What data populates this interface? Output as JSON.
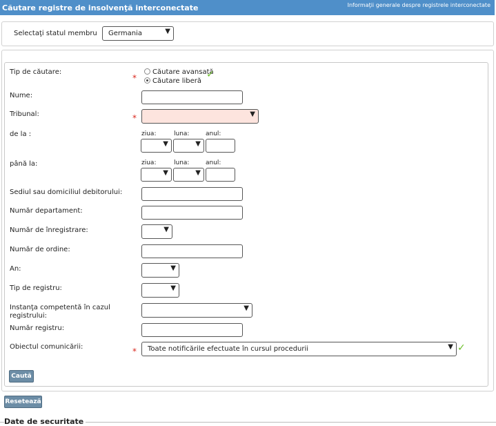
{
  "header": {
    "title": "Căutare registre de insolvenţă interconectate",
    "info_link": "Informaţii generale despre registrele interconectate"
  },
  "member_state": {
    "label": "Selectaţi statul membru",
    "selected": "Germania"
  },
  "search_type": {
    "label": "Tip de căutare:",
    "options": [
      "Căutare avansată",
      "Căutare liberă"
    ],
    "selected_index": 1
  },
  "fields": {
    "name_label": "Nume:",
    "court_label": "Tribunal:",
    "from_label": "de la :",
    "to_label": "până la:",
    "day_label": "ziua:",
    "month_label": "luna:",
    "year_label": "anul:",
    "seat_label": "Sediul sau domiciliul debitorului:",
    "department_label": "Număr departament:",
    "registration_label": "Număr de înregistrare:",
    "order_label": "Număr de ordine:",
    "year_field_label": "An:",
    "register_type_label": "Tip de registru:",
    "competent_court_label": "Instanţa competentă în cazul registrului:",
    "register_number_label": "Număr registru:",
    "subject_label": "Obiectul comunicării:",
    "subject_value": "Toate notificările efectuate în cursul procedurii"
  },
  "buttons": {
    "search": "Caută",
    "reset": "Resetează"
  },
  "security": {
    "title": "Date de securitate"
  },
  "colors": {
    "header_bg": "#4f8fc9",
    "required_star": "#d9261c",
    "valid_check": "#6cbf2a",
    "court_field_bg": "#fde4de",
    "button_bg": "#6c8da6"
  },
  "icons": {
    "required": "asterisk",
    "valid": "check-icon",
    "dropdown": "triangle-down"
  }
}
